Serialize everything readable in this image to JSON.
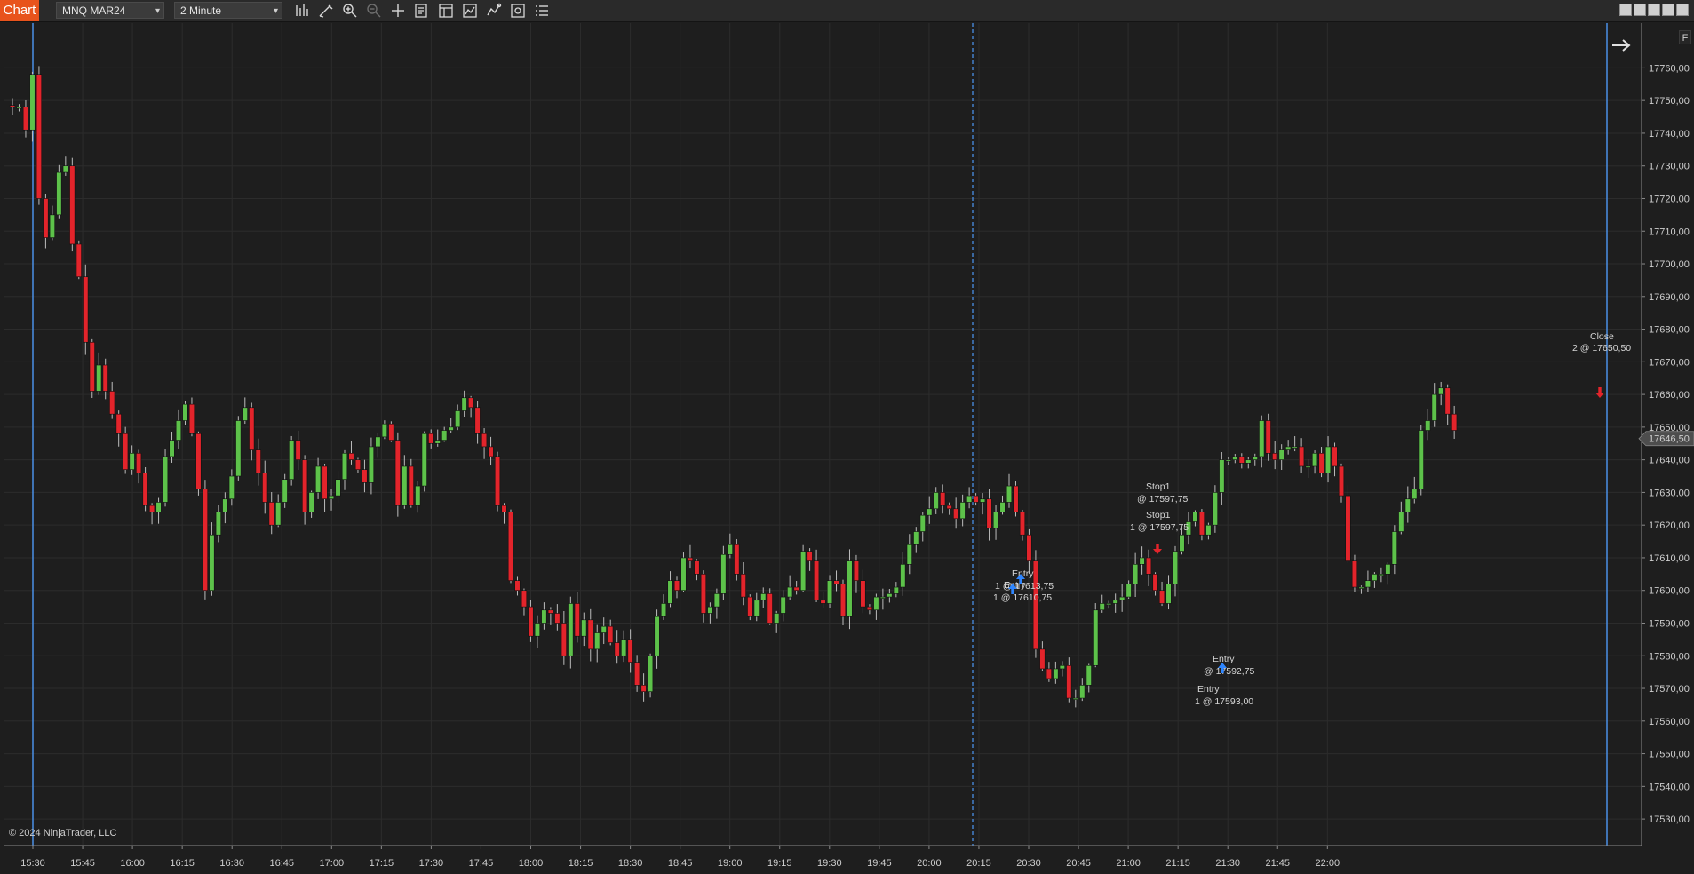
{
  "toolbar": {
    "tab_label": "Chart",
    "instrument": "MNQ MAR24",
    "timeframe": "2 Minute",
    "icons": [
      "bar-type-icon",
      "draw-icon",
      "zoom-in-icon",
      "zoom-out-icon",
      "crosshair-icon",
      "data-box-icon",
      "templates-icon",
      "strategies-icon",
      "indicators-icon",
      "properties-icon",
      "list-icon"
    ]
  },
  "corner_label": "F",
  "copyright": "© 2024 NinjaTrader, LLC",
  "price_marker": "17646,50",
  "colors": {
    "background": "#1e1e1e",
    "up_candle": "#5dc24a",
    "down_candle": "#e3242b",
    "session_line": "#4a8fe6",
    "price_marker_bg": "#4d4d4d",
    "buy_arrow": "#2f86ff",
    "sell_arrow": "#e3242b"
  },
  "chart_data": {
    "type": "candlestick",
    "instrument": "MNQ MAR24",
    "interval": "2 Minute",
    "y_ticks": [
      "17760,00",
      "17750,00",
      "17740,00",
      "17730,00",
      "17720,00",
      "17710,00",
      "17700,00",
      "17690,00",
      "17680,00",
      "17670,00",
      "17660,00",
      "17650,00",
      "17640,00",
      "17630,00",
      "17620,00",
      "17610,00",
      "17600,00",
      "17590,00",
      "17580,00",
      "17570,00",
      "17560,00",
      "17550,00",
      "17540,00",
      "17530,00"
    ],
    "x_ticks": [
      "15:30",
      "15:45",
      "16:00",
      "16:15",
      "16:30",
      "16:45",
      "17:00",
      "17:15",
      "17:30",
      "17:45",
      "18:00",
      "18:15",
      "18:30",
      "18:45",
      "19:00",
      "19:15",
      "19:30",
      "19:45",
      "20:00",
      "20:15",
      "20:30",
      "20:45",
      "21:00",
      "21:15",
      "21:30",
      "21:45",
      "22:00"
    ],
    "ylim": [
      17525,
      17763
    ],
    "session_start": "15:30",
    "session_end": "22:00",
    "break_time": "19:22",
    "last_price": 17646.5,
    "closes": [
      17748,
      17748,
      17741,
      17758,
      17720,
      17708,
      17715,
      17728,
      17730,
      17706,
      17696,
      17676,
      17661,
      17669,
      17661,
      17654,
      17648,
      17637,
      17642,
      17636,
      17626,
      17624,
      17627,
      17641,
      17646,
      17652,
      17657,
      17648,
      17631,
      17600,
      17617,
      17624,
      17628,
      17635,
      17652,
      17656,
      17643,
      17636,
      17627,
      17620,
      17627,
      17634,
      17646,
      17640,
      17624,
      17630,
      17638,
      17628,
      17629,
      17634,
      17642,
      17640,
      17637,
      17633,
      17644,
      17647,
      17651,
      17646,
      17626,
      17638,
      17626,
      17632,
      17648,
      17645,
      17646,
      17649,
      17650,
      17655,
      17659,
      17656,
      17648,
      17644,
      17641,
      17626,
      17624,
      17603,
      17600,
      17595,
      17586,
      17590,
      17594,
      17593,
      17590,
      17580,
      17596,
      17586,
      17591,
      17582,
      17587,
      17589,
      17584,
      17580,
      17585,
      17578,
      17571,
      17569,
      17580,
      17592,
      17596,
      17603,
      17600,
      17610,
      17609,
      17605,
      17593,
      17595,
      17599,
      17611,
      17614,
      17605,
      17598,
      17592,
      17597,
      17599,
      17590,
      17593,
      17598,
      17601,
      17600,
      17612,
      17609,
      17597,
      17596,
      17603,
      17602,
      17592,
      17609,
      17603,
      17595,
      17594,
      17598,
      17598,
      17599,
      17601,
      17608,
      17614,
      17618,
      17623,
      17625,
      17630,
      17626,
      17625,
      17622,
      17627,
      17629,
      17627,
      17628,
      17619,
      17624,
      17627,
      17632,
      17624,
      17617,
      17609,
      17582,
      17576,
      17573,
      17576,
      17577,
      17567,
      17567,
      17571,
      17577,
      17594,
      17596,
      17596,
      17597,
      17598,
      17602,
      17608,
      17610,
      17605,
      17600,
      17596,
      17602,
      17612,
      17617,
      17621,
      17624,
      17617,
      17620,
      17630,
      17640,
      17640,
      17641,
      17639,
      17640,
      17641,
      17652,
      17642,
      17640,
      17643,
      17644,
      17644,
      17638,
      17638,
      17642,
      17636,
      17644,
      17638,
      17629,
      17609,
      17601,
      17601,
      17603,
      17605,
      17605,
      17608,
      17618,
      17624,
      17628,
      17631,
      17649,
      17652,
      17660,
      17662,
      17654,
      17649
    ],
    "annotations": [
      {
        "label": "Stop1",
        "detail": "@ 17597,75"
      },
      {
        "label": "Stop1",
        "detail": "1 @ 17597,75"
      },
      {
        "label": "Entry",
        "detail": "1 @ 17613,75"
      },
      {
        "label": "Entry",
        "detail": "1 @ 17610,75"
      },
      {
        "label": "Entry",
        "detail": "@ 17592,75"
      },
      {
        "label": "Entry",
        "detail": "1 @ 17593,00"
      },
      {
        "label": "Close",
        "detail": "2 @ 17650,50"
      }
    ]
  }
}
